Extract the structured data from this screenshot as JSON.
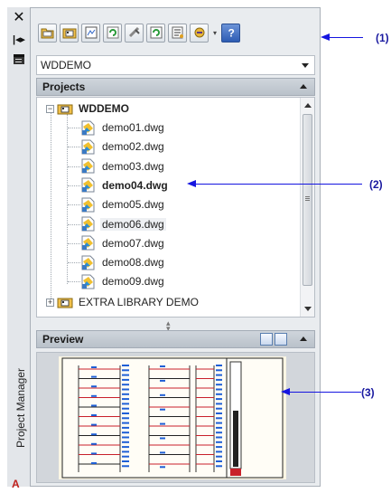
{
  "palette": {
    "title": "Project Manager",
    "close_glyph": "✕",
    "auto_hide_glyph": "|◂▸"
  },
  "toolbar": {
    "buttons": [
      {
        "icon": "open-project-icon"
      },
      {
        "icon": "new-project-icon"
      },
      {
        "icon": "new-drawing-icon"
      },
      {
        "icon": "refresh-icon"
      },
      {
        "icon": "project-wide-update-icon"
      },
      {
        "icon": "project-wide-utilities-icon"
      },
      {
        "icon": "drawing-list-report-icon"
      },
      {
        "icon": "project-task-list-icon"
      },
      {
        "icon": "help-icon"
      }
    ]
  },
  "project_select": {
    "value": "WDDEMO"
  },
  "projects_section": {
    "title": "Projects"
  },
  "tree": {
    "root": {
      "label": "WDDEMO",
      "expander": "−"
    },
    "drawings": [
      {
        "label": "demo01.dwg",
        "bold": false,
        "selected": false
      },
      {
        "label": "demo02.dwg",
        "bold": false,
        "selected": false
      },
      {
        "label": "demo03.dwg",
        "bold": false,
        "selected": false
      },
      {
        "label": "demo04.dwg",
        "bold": true,
        "selected": false
      },
      {
        "label": "demo05.dwg",
        "bold": false,
        "selected": false
      },
      {
        "label": "demo06.dwg",
        "bold": false,
        "selected": true
      },
      {
        "label": "demo07.dwg",
        "bold": false,
        "selected": false
      },
      {
        "label": "demo08.dwg",
        "bold": false,
        "selected": false
      },
      {
        "label": "demo09.dwg",
        "bold": false,
        "selected": false
      }
    ],
    "other_project": {
      "label": "EXTRA LIBRARY DEMO",
      "expander": "+"
    }
  },
  "preview_section": {
    "title": "Preview"
  },
  "callouts": [
    {
      "label": "(1)"
    },
    {
      "label": "(2)"
    },
    {
      "label": "(3)"
    }
  ],
  "colors": {
    "callout": "#1515e0",
    "panel_bg": "#e9ecef",
    "header_bg": "#c4cbd3",
    "wire_red": "#c8202a",
    "wire_blue": "#1e5fd6"
  }
}
